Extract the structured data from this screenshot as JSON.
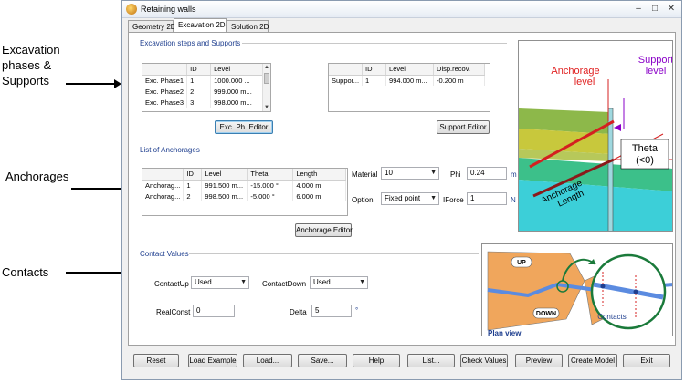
{
  "callouts": {
    "excavation": [
      "Excavation",
      "phases &",
      "Supports"
    ],
    "anchorages": "Anchorages",
    "contacts": "Contacts"
  },
  "window": {
    "title": "Retaining walls",
    "minimize": "–",
    "maximize": "□",
    "close": "✕"
  },
  "tabs": [
    "Geometry 2D",
    "Excavation 2D",
    "Solution 2D"
  ],
  "excavation": {
    "title": "Excavation steps and Supports",
    "phases": {
      "columns": [
        "",
        "ID",
        "Level"
      ],
      "rows": [
        [
          "Exc. Phase1",
          "1",
          "1000.000 ..."
        ],
        [
          "Exc. Phase2",
          "2",
          "999.000 m..."
        ],
        [
          "Exc. Phase3",
          "3",
          "998.000 m..."
        ]
      ]
    },
    "supports": {
      "columns": [
        "",
        "ID",
        "Level",
        "Disp.recov."
      ],
      "rows": [
        [
          "Suppor...",
          "1",
          "994.000 m...",
          "-0.200 m"
        ]
      ]
    },
    "phase_editor_button": "Exc. Ph. Editor",
    "support_editor_button": "Support Editor"
  },
  "anchorages": {
    "title": "List of Anchorages",
    "columns": [
      "",
      "ID",
      "Level",
      "Theta",
      "Length"
    ],
    "rows": [
      [
        "Anchorag...",
        "1",
        "991.500 m...",
        "-15.000 °",
        "4.000 m"
      ],
      [
        "Anchorag...",
        "2",
        "998.500 m...",
        "-5.000 °",
        "6.000 m"
      ]
    ],
    "material_label": "Material",
    "material_value": "10",
    "option_label": "Option",
    "option_value": "Fixed point",
    "phi_label": "Phi",
    "phi_value": "0.24",
    "phi_unit": "m",
    "iforce_label": "IForce",
    "iforce_value": "1",
    "iforce_unit": "N",
    "editor_button": "Anchorage Editor"
  },
  "contacts": {
    "title": "Contact Values",
    "contact_up_label": "ContactUp",
    "contact_up_value": "Used",
    "contact_down_label": "ContactDown",
    "contact_down_value": "Used",
    "realconst_label": "RealConst",
    "realconst_value": "0",
    "delta_label": "Delta",
    "delta_value": "5",
    "delta_unit": "°"
  },
  "figure_anchorage": {
    "anchorage_level": [
      "Anchorage",
      "level"
    ],
    "support_level": [
      "Support",
      "level"
    ],
    "anchorage_length": [
      "Anchorage",
      "Length"
    ],
    "theta": [
      "Theta",
      "(<0)"
    ],
    "colors": {
      "soil_top": "#8db84a",
      "soil_mid": "#c8c83c",
      "soil_low": "#3cc08a",
      "soil_water": "#3ccfd8",
      "anchor": "#d42020",
      "anchor_length": "#8a1a1a",
      "support": "#8a00c8"
    }
  },
  "figure_plan": {
    "up": "UP",
    "down": "DOWN",
    "contacts": "Contacts",
    "plan_view": "Plan view",
    "colors": {
      "ground": "#f0a65c",
      "line": "#5b8be0",
      "circle": "#1a7a3a"
    }
  },
  "bottom_buttons": [
    "Reset",
    "Load Example",
    "Load...",
    "Save...",
    "Help",
    "List...",
    "Check Values",
    "Preview",
    "Create Model",
    "Exit"
  ]
}
